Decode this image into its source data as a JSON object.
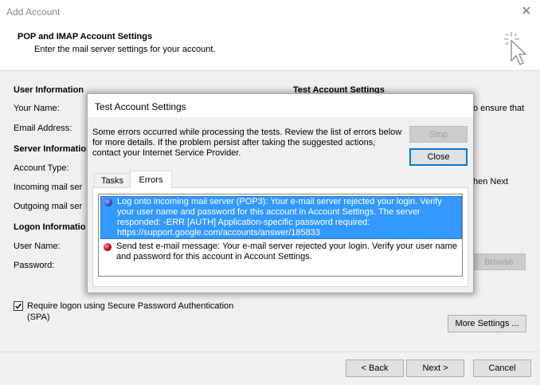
{
  "window": {
    "title": "Add Account"
  },
  "header": {
    "title": "POP and IMAP Account Settings",
    "subtitle": "Enter the mail server settings for your account."
  },
  "form": {
    "user_info_heading": "User Information",
    "your_name_label": "Your Name:",
    "email_label": "Email Address:",
    "server_info_heading": "Server Information",
    "account_type_label": "Account Type:",
    "incoming_label": "Incoming mail ser",
    "outgoing_label": "Outgoing mail ser",
    "logon_heading": "Logon Informatio",
    "username_label": "User Name:",
    "password_label": "Password:",
    "test_heading": "Test Account Settings",
    "right_text_1": "o ensure that",
    "right_text_2": "hen Next",
    "browse_label": "Browse",
    "spa_label_line1": "Require logon using Secure Password Authentication",
    "spa_label_line2": "(SPA)",
    "spa_checked": true,
    "more_settings_label": "More Settings ..."
  },
  "footer": {
    "back_label": "< Back",
    "next_label": "Next >",
    "cancel_label": "Cancel"
  },
  "dialog": {
    "title": "Test Account Settings",
    "message": "Some errors occurred while processing the tests. Review the list of errors below for more details. If the problem persist after taking the suggested actions, contact your Internet Service Provider.",
    "stop_label": "Stop",
    "close_label": "Close",
    "tabs": [
      {
        "label": "Tasks",
        "active": false
      },
      {
        "label": "Errors",
        "active": true
      }
    ],
    "errors": [
      {
        "text": "Log onto incoming mail server (POP3): Your e-mail server rejected your login. Verify your user name and password for this account in Account Settings.  The server responded: -ERR [AUTH] Application-specific password required: https://support.google.com/accounts/answer/185833",
        "icon": "info-error-icon",
        "selected": true
      },
      {
        "text": "Send test e-mail message: Your e-mail server rejected your login. Verify your user name and password for this account in Account Settings.",
        "icon": "error-icon",
        "selected": false
      }
    ]
  },
  "colors": {
    "selection": "#3399ff",
    "default_button_border": "#0078d7"
  }
}
